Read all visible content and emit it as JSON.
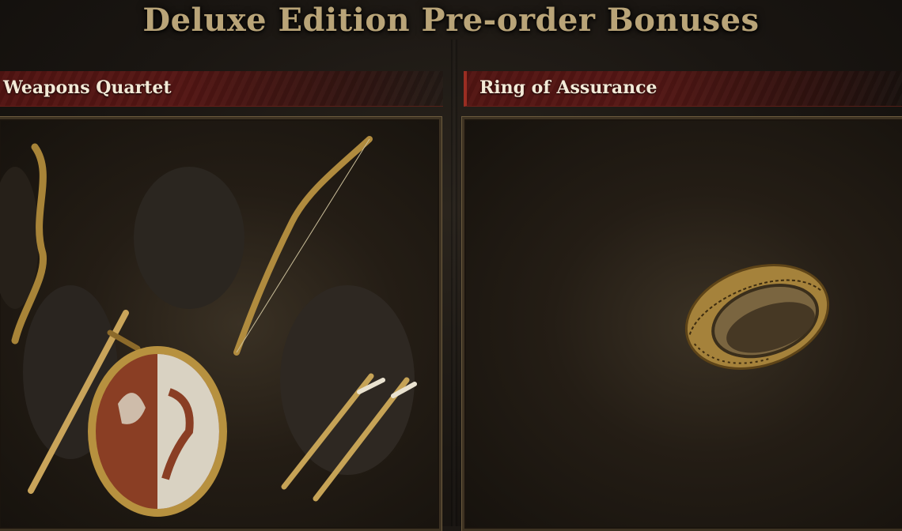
{
  "page": {
    "title": "Deluxe Edition Pre-order Bonuses"
  },
  "sections": [
    {
      "label": "Weapons Quartet",
      "image": "weapons-quartet-art"
    },
    {
      "label": "Ring of Assurance",
      "image": "ring-of-assurance-art"
    }
  ],
  "colors": {
    "title_gold": "#b9a478",
    "banner_red": "#5f1614",
    "frame_border": "#6b5a3d",
    "item_gold": "#b48a3b"
  }
}
